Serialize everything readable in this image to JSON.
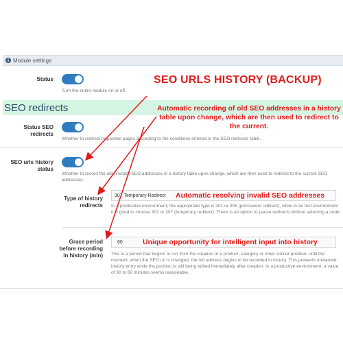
{
  "module_bar": {
    "icon": "info-icon",
    "title": "Module settings"
  },
  "status": {
    "label": "Status",
    "help": "Turn the entire module on or off.",
    "enabled": true
  },
  "seo_redirects": {
    "section_title": "SEO redirects",
    "status_label": "Status SEO redirects",
    "status_help": "Whether to redirect requested pages according to the conditions entered in the SEO redirects table.",
    "status_enabled": true
  },
  "history": {
    "label": "SEO urls history status",
    "help": "Whether to record the old (invalid) SEO addresses in a history table upon change, which are then used to redirect to the current SEO addresses.",
    "enabled": true,
    "redirect_type": {
      "label": "Type of history redirects",
      "value": "307 Temporary Redirect",
      "help": "In a productive environment, the appropriate type is 301 or 308 (permanent redirect), while in an test environment it is good to choose 302 or 307 (temporary redirect). There is an option to pause redirects without selecting a code."
    },
    "grace_period": {
      "label": "Grace period before recording in history (min)",
      "value": "60",
      "help": "This is a period that begins to run from the creation of a product, category or other similar position, until the moment, when the SEO url is changed, the old address begins to be recorded in history. This prevents unwanted history entry while the position is still being edited immediately after creation. In a productive environment, a value of 30 to 60 minutes seems reasonable."
    }
  },
  "annotations": {
    "title": "SEO URLS HISTORY (BACKUP)",
    "auto_recording": "Automatic recording of old SEO addresses in a history table upon change, which are then used to redirect to the current.",
    "auto_resolving": "Automatic resolving invalid SEO addresses",
    "unique_opportunity": "Unique opportunity for intelligent input into history"
  },
  "colors": {
    "accent": "#2f7cc1",
    "annotation": "#e01b1b",
    "section_bg": "#d5f5e3"
  }
}
